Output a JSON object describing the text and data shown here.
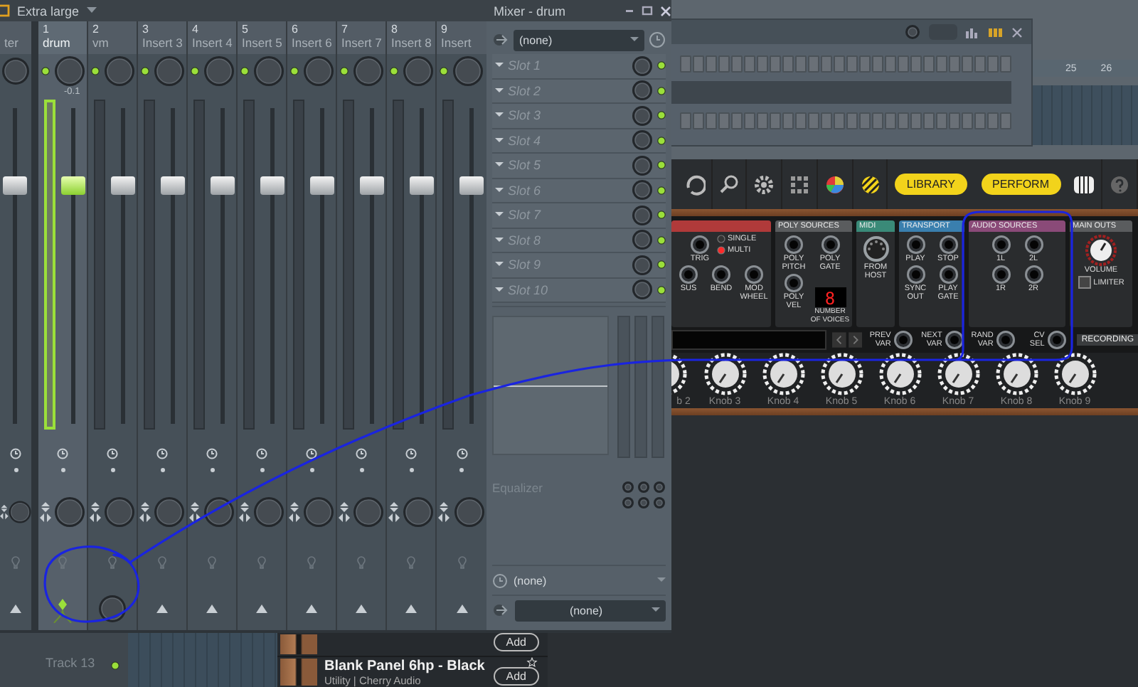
{
  "channel_rack": {
    "ruler": [
      "25",
      "26"
    ]
  },
  "mixer": {
    "view_mode": "Extra large",
    "title": "Mixer - drum",
    "strips": [
      {
        "name": "ter",
        "selected": false,
        "level": 0.75,
        "kind": "plain"
      },
      {
        "number": "1",
        "name": "drum",
        "selected": true,
        "reading": "-0.1",
        "level": 0.75,
        "kind": "source"
      },
      {
        "number": "2",
        "name": "vm",
        "selected": false,
        "level": 0.75,
        "kind": "send"
      },
      {
        "number": "3",
        "name": "Insert 3",
        "selected": false,
        "level": 0.75,
        "kind": "plain"
      },
      {
        "number": "4",
        "name": "Insert 4",
        "selected": false,
        "level": 0.75,
        "kind": "plain"
      },
      {
        "number": "5",
        "name": "Insert 5",
        "selected": false,
        "level": 0.75,
        "kind": "plain"
      },
      {
        "number": "6",
        "name": "Insert 6",
        "selected": false,
        "level": 0.75,
        "kind": "plain"
      },
      {
        "number": "7",
        "name": "Insert 7",
        "selected": false,
        "level": 0.75,
        "kind": "plain"
      },
      {
        "number": "8",
        "name": "Insert 8",
        "selected": false,
        "level": 0.75,
        "kind": "plain"
      },
      {
        "number": "9",
        "name": "Insert",
        "selected": false,
        "level": 0.75,
        "kind": "plain"
      }
    ],
    "insert": {
      "preset": "(none)",
      "slots": [
        {
          "label": "Slot 1",
          "enabled": true
        },
        {
          "label": "Slot 2",
          "enabled": true
        },
        {
          "label": "Slot 3",
          "enabled": true
        },
        {
          "label": "Slot 4",
          "enabled": true
        },
        {
          "label": "Slot 5",
          "enabled": true
        },
        {
          "label": "Slot 6",
          "enabled": true
        },
        {
          "label": "Slot 7",
          "enabled": true
        },
        {
          "label": "Slot 8",
          "enabled": true
        },
        {
          "label": "Slot 9",
          "enabled": true
        },
        {
          "label": "Slot 10",
          "enabled": true
        }
      ],
      "equalizer": "Equalizer",
      "input": "(none)",
      "output": "(none)"
    }
  },
  "plugin": {
    "toolbar_buttons": [
      "LIBRARY",
      "PERFORM"
    ],
    "sections": [
      {
        "color": "#b03a3a",
        "items": [
          {
            "kind": "jack",
            "label": "TRIG"
          },
          {
            "kind": "switch",
            "options": [
              {
                "label": "SINGLE",
                "selected": false
              },
              {
                "label": "MULTI",
                "selected": true
              }
            ]
          },
          {
            "kind": "jack",
            "label": "SUS"
          },
          {
            "kind": "jack",
            "label": "BEND"
          },
          {
            "kind": "jack",
            "label": "MOD WHEEL"
          }
        ]
      },
      {
        "title": "POLY SOURCES",
        "color": "#5a5c5e",
        "items": [
          {
            "kind": "jack",
            "label": "POLY PITCH"
          },
          {
            "kind": "jack",
            "label": "POLY GATE"
          },
          {
            "kind": "jack",
            "label": "POLY VEL"
          },
          {
            "kind": "display",
            "value": "8",
            "label": "NUMBER OF VOICES"
          }
        ]
      },
      {
        "title": "MIDI",
        "color": "#3a8a78",
        "items": [
          {
            "kind": "midi",
            "label": "FROM HOST"
          }
        ]
      },
      {
        "title": "TRANSPORT",
        "color": "#3a7fae",
        "items": [
          {
            "kind": "jack",
            "label": "PLAY"
          },
          {
            "kind": "jack",
            "label": "STOP"
          },
          {
            "kind": "jack",
            "label": "SYNC OUT"
          },
          {
            "kind": "jack",
            "label": "PLAY GATE"
          }
        ]
      },
      {
        "title": "AUDIO SOURCES",
        "color": "#8a4a78",
        "items": [
          {
            "kind": "jack",
            "label": "1L"
          },
          {
            "kind": "jack",
            "label": "2L"
          },
          {
            "kind": "jack",
            "label": "1R"
          },
          {
            "kind": "jack",
            "label": "2R"
          }
        ]
      },
      {
        "title": "MAIN OUTS",
        "color": "#5a5c5e",
        "items": [
          {
            "kind": "knob",
            "label": "VOLUME"
          },
          {
            "kind": "checkbox",
            "label": "LIMITER",
            "checked": false
          }
        ]
      }
    ],
    "variation_jacks": [
      "PREV VAR",
      "NEXT VAR",
      "RAND VAR",
      "CV SEL"
    ],
    "recording": "RECORDING",
    "knobs": [
      "b 2",
      "Knob 3",
      "Knob 4",
      "Knob 5",
      "Knob 6",
      "Knob 7",
      "Knob 8",
      "Knob 9"
    ]
  },
  "playlist": {
    "track": "Track 13"
  },
  "browser": {
    "items": [
      {
        "button": "Add"
      },
      {
        "title": "Blank Panel 6hp - Black",
        "subtitle": "Utility | Cherry Audio",
        "button": "Add"
      }
    ]
  }
}
